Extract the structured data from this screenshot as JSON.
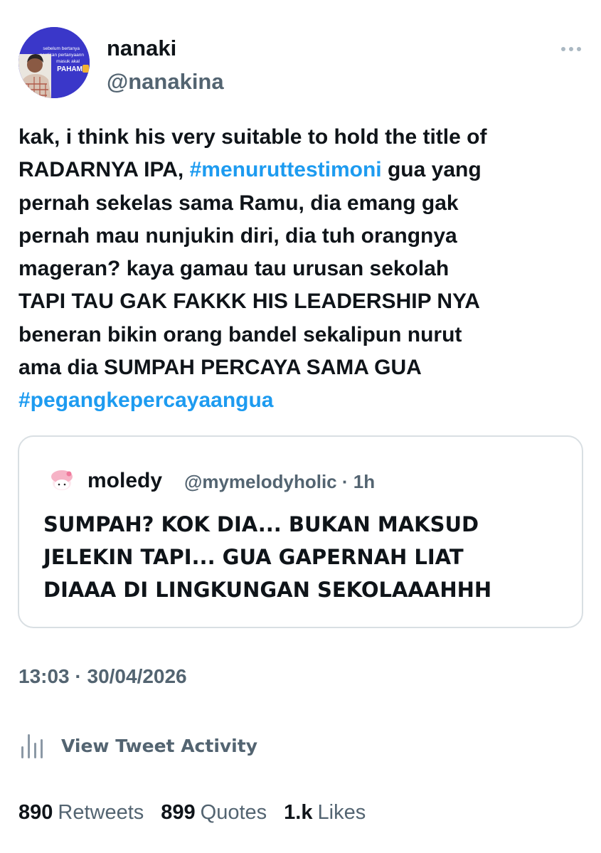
{
  "author": {
    "display_name": "nanaki",
    "handle": "@nanakina",
    "avatar_text": [
      "sebelum bertanya",
      "pastikan pertanyaann",
      "masuk akal",
      "PAHAM"
    ]
  },
  "tweet": {
    "lines": [
      [
        {
          "t": "kak, i think his very suitable to hold the title of"
        }
      ],
      [
        {
          "t": "RADARNYA IPA, "
        },
        {
          "t": "#menuruttestimoni",
          "tag": true
        },
        {
          "t": " gua yang"
        }
      ],
      [
        {
          "t": "pernah sekelas sama Ramu, dia emang gak"
        }
      ],
      [
        {
          "t": "pernah mau nunjukin diri, dia tuh orangnya"
        }
      ],
      [
        {
          "t": "mageran? kaya gamau tau urusan sekolah"
        }
      ],
      [
        {
          "t": "TAPI TAU GAK FAKKK HIS LEADERSHIP NYA"
        }
      ],
      [
        {
          "t": "beneran bikin orang bandel sekalipun nurut"
        }
      ],
      [
        {
          "t": "ama dia SUMPAH PERCAYA SAMA GUA"
        }
      ],
      [
        {
          "t": "#pegangkepercayaangua",
          "tag": true
        }
      ]
    ]
  },
  "quote": {
    "display_name": "moledy",
    "meta": "@mymelodyholic · 1h",
    "lines": [
      "SUMPAH? KOK DIA... BUKAN MAKSUD",
      "JELEKIN TAPI... GUA GAPERNAH LIAT",
      "DIAAA DI LINGKUNGAN SEKOLAAAHHH"
    ]
  },
  "timestamp": "13:03 · 30/04/2026",
  "activity_label": "View Tweet Activity",
  "stats": [
    {
      "num": "890",
      "label": "Retweets"
    },
    {
      "num": "899",
      "label": "Quotes"
    },
    {
      "num": "1.k",
      "label": "Likes"
    }
  ],
  "colors": {
    "hashtag": "#1d9bf0",
    "secondary_text": "#536471",
    "avatar_bg": "#3a37c9"
  },
  "icons": {
    "more": "more-dots-icon",
    "activity": "bar-chart-icon"
  }
}
